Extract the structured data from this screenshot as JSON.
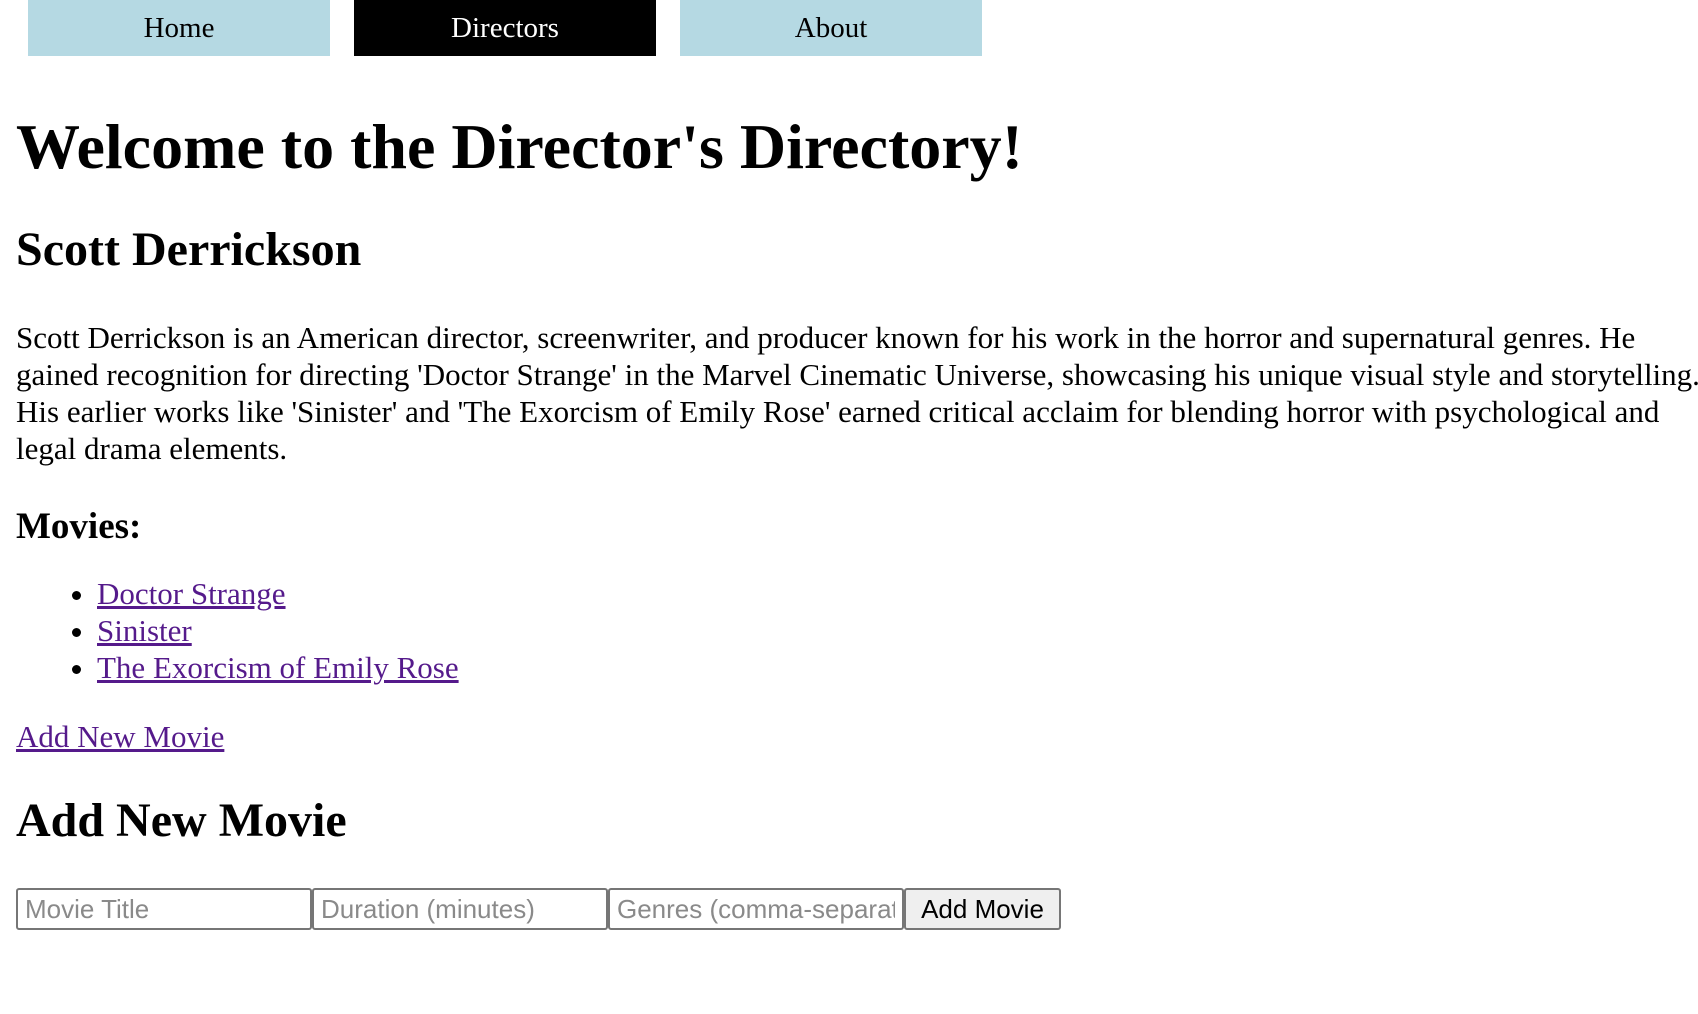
{
  "nav": {
    "tabs": [
      {
        "label": "Home",
        "active": false
      },
      {
        "label": "Directors",
        "active": true
      },
      {
        "label": "About",
        "active": false
      }
    ],
    "colors": {
      "tab_bg": "#b5d9e3",
      "active_bg": "#000000",
      "active_text": "#ffffff"
    }
  },
  "main": {
    "title": "Welcome to the Director's Directory!",
    "director": {
      "name": "Scott Derrickson",
      "bio": "Scott Derrickson is an American director, screenwriter, and producer known for his work in the horror and supernatural genres. He gained recognition for directing 'Doctor Strange' in the Marvel Cinematic Universe, showcasing his unique visual style and storytelling. His earlier works like 'Sinister' and 'The Exorcism of Emily Rose' earned critical acclaim for blending horror with psychological and legal drama elements."
    },
    "movies_heading": "Movies:",
    "movies": [
      "Doctor Strange",
      "Sinister",
      "The Exorcism of Emily Rose"
    ],
    "add_link": "Add New Movie"
  },
  "form": {
    "heading": "Add New Movie",
    "title_placeholder": "Movie Title",
    "duration_placeholder": "Duration (minutes)",
    "genres_placeholder": "Genres (comma-separated)",
    "submit_label": "Add Movie"
  }
}
